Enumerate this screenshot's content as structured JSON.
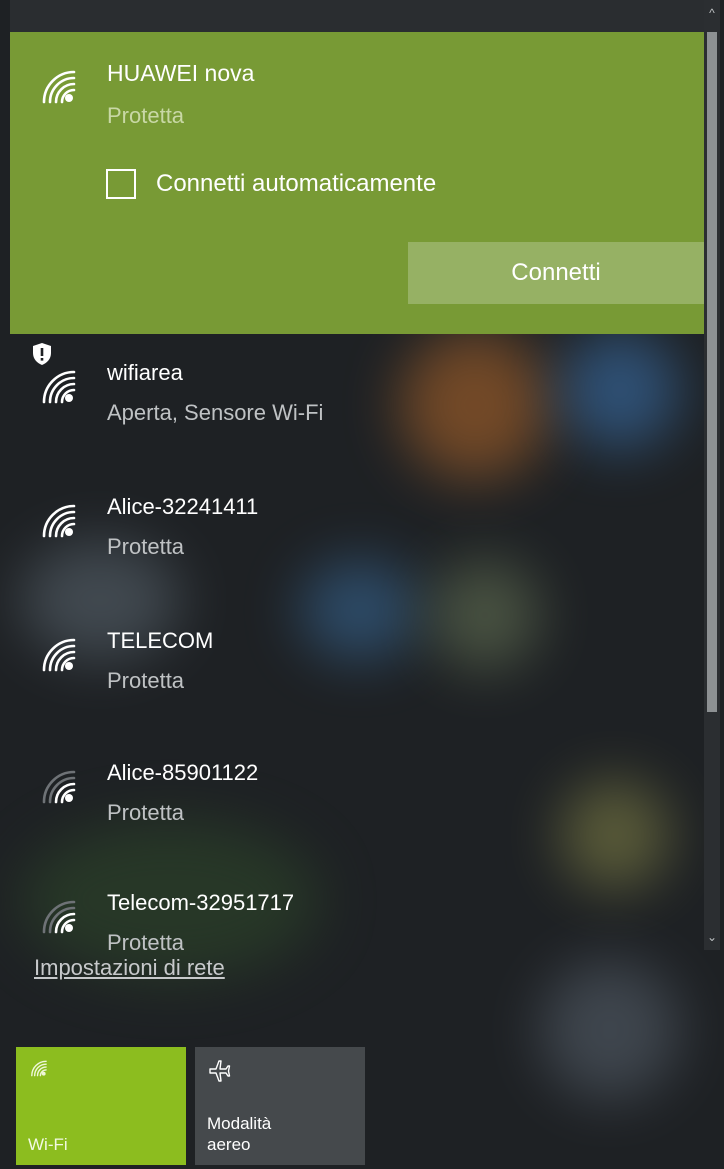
{
  "expanded_network": {
    "name": "HUAWEI nova",
    "status": "Protetta",
    "auto_connect_label": "Connetti automaticamente",
    "connect_label": "Connetti"
  },
  "networks": [
    {
      "name": "wifiarea",
      "status": "Aperta, Sensore Wi-Fi",
      "icon": "wifi-warning-icon"
    },
    {
      "name": "Alice-32241411",
      "status": "Protetta",
      "icon": "wifi-signal-icon"
    },
    {
      "name": "TELECOM",
      "status": "Protetta",
      "icon": "wifi-signal-icon"
    },
    {
      "name": "Alice-85901122",
      "status": "Protetta",
      "icon": "wifi-signal-icon"
    },
    {
      "name": "Telecom-32951717",
      "status": "Protetta",
      "icon": "wifi-signal-icon"
    }
  ],
  "settings_link": "Impostazioni di rete",
  "quick_actions": {
    "wifi_label": "Wi-Fi",
    "airplane_label_line1": "Modalità",
    "airplane_label_line2": "aereo"
  },
  "colors": {
    "accent": "#789a35",
    "wifi_tile": "#8cbd1f"
  }
}
